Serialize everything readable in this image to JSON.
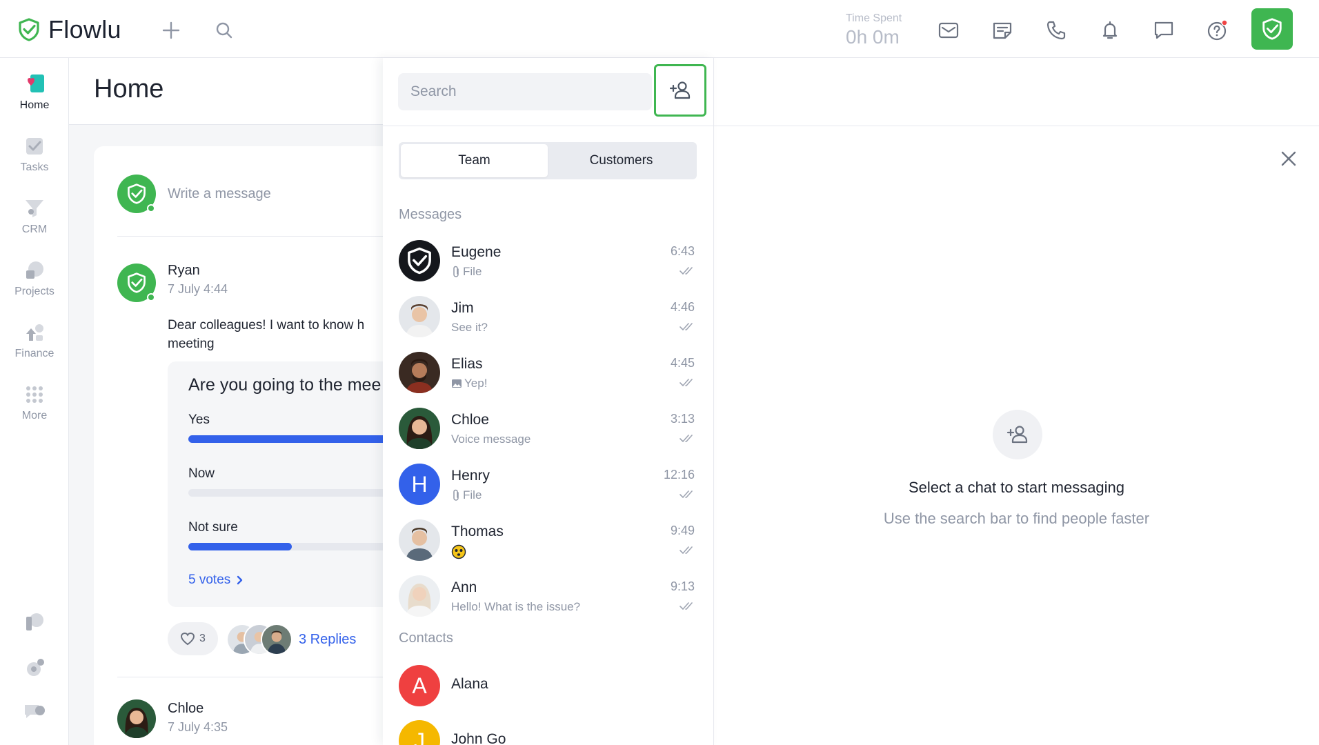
{
  "app": {
    "name": "Flowlu",
    "brand_color": "#3fb651",
    "accent_color": "#3361ea"
  },
  "topbar": {
    "time_spent_label": "Time Spent",
    "time_spent_value": "0h 0m",
    "icons": [
      "plus-icon",
      "search-icon",
      "mail-icon",
      "note-icon",
      "phone-icon",
      "bell-icon",
      "chat-icon",
      "help-icon",
      "flowlu-check-icon"
    ]
  },
  "nav": {
    "items": [
      {
        "label": "Home",
        "icon": "home-icon",
        "active": true
      },
      {
        "label": "Tasks",
        "icon": "tasks-icon"
      },
      {
        "label": "CRM",
        "icon": "crm-icon"
      },
      {
        "label": "Projects",
        "icon": "projects-icon"
      },
      {
        "label": "Finance",
        "icon": "finance-icon"
      },
      {
        "label": "More",
        "icon": "grid-icon"
      }
    ],
    "bottom_icons": [
      "parking-icon",
      "settings-icon",
      "support-icon"
    ]
  },
  "home": {
    "title": "Home",
    "write_placeholder": "Write a message",
    "post": {
      "author": "Ryan",
      "date": "7 July 4:44",
      "text": "Dear colleagues! I want to know h meeting",
      "poll": {
        "question": "Are you going to the mee",
        "options": [
          {
            "label": "Yes",
            "fraction": 1.0
          },
          {
            "label": "Now",
            "fraction": 0.0
          },
          {
            "label": "Not sure",
            "fraction": 0.5
          }
        ],
        "votes": "5 votes"
      },
      "likes": "3",
      "replies": "3 Replies"
    },
    "next_post": {
      "author": "Chloe",
      "date": "7 July 4:35"
    }
  },
  "chat": {
    "search_placeholder": "Search",
    "tabs": {
      "team": "Team",
      "customers": "Customers"
    },
    "messages_label": "Messages",
    "messages": [
      {
        "name": "Eugene",
        "preview": "File",
        "preview_icon": "paperclip-icon",
        "time": "6:43",
        "avatar": "logo"
      },
      {
        "name": "Jim",
        "preview": "See it?",
        "time": "4:46",
        "avatar": "photo",
        "skin": "#e9c4a6",
        "hair": "#5a4030",
        "shirt": "#f2f2f2"
      },
      {
        "name": "Elias",
        "preview": "Yep!",
        "preview_icon": "image-icon",
        "time": "4:45",
        "avatar": "photo",
        "skin": "#b67c5a",
        "hair": "#2a1a12",
        "shirt": "#8b2f20"
      },
      {
        "name": "Chloe",
        "preview": "Voice message",
        "time": "3:13",
        "avatar": "photo",
        "skin": "#e8b896",
        "hair": "#2c1c14",
        "shirt": "#2a5a3a"
      },
      {
        "name": "Henry",
        "preview": "File",
        "preview_icon": "paperclip-icon",
        "time": "12:16",
        "avatar": "letter",
        "letter": "H",
        "color": "#3361ea"
      },
      {
        "name": "Thomas",
        "preview": "",
        "preview_icon": "emoji-icon",
        "time": "9:49",
        "avatar": "photo",
        "skin": "#e5c0a2",
        "hair": "#4a3828",
        "shirt": "#5a6a7a"
      },
      {
        "name": "Ann",
        "preview": "Hello! What is the issue?",
        "time": "9:13",
        "avatar": "photo",
        "skin": "#f0d2bc",
        "hair": "#e8dccc",
        "shirt": "#f5f5f5"
      }
    ],
    "contacts_label": "Contacts",
    "contacts": [
      {
        "name": "Alana",
        "letter": "A",
        "color": "#ef4040"
      },
      {
        "name": "John Go",
        "letter": "J",
        "color": "#f5b800"
      }
    ]
  },
  "empty_state": {
    "title": "Select a chat to start messaging",
    "subtitle": "Use the search bar to find people faster"
  }
}
